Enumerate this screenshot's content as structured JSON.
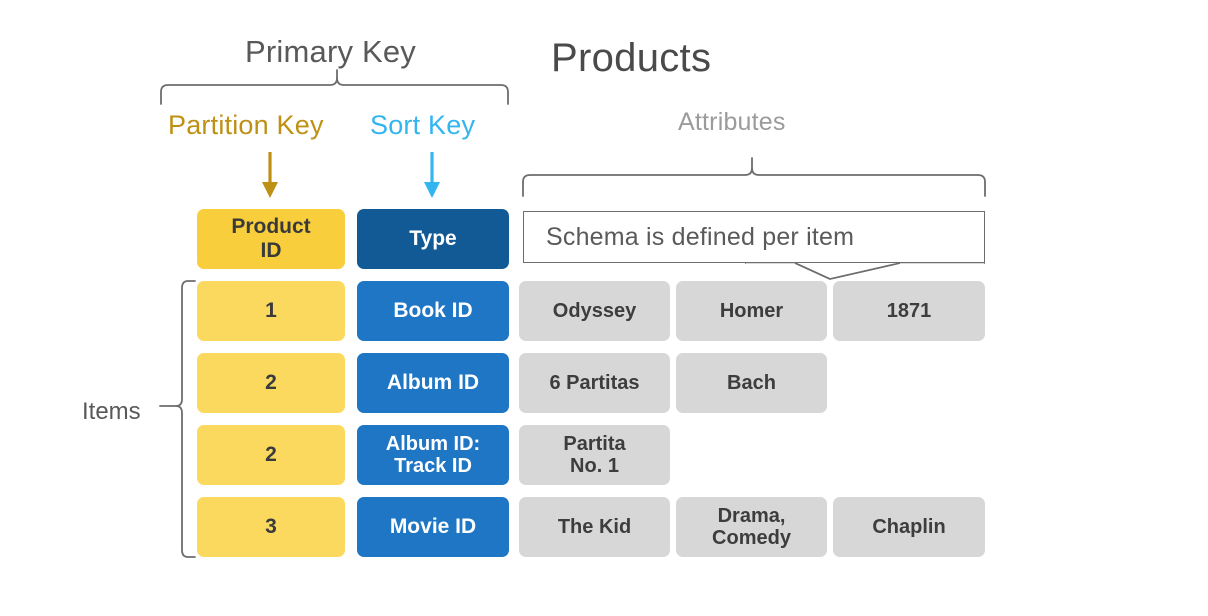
{
  "title": "Products",
  "labels": {
    "primary_key": "Primary Key",
    "partition_key": "Partition Key",
    "sort_key": "Sort Key",
    "attributes": "Attributes",
    "items": "Items"
  },
  "callout": {
    "text": "Schema is defined per item"
  },
  "colors": {
    "partition_key_text": "#BE9115",
    "sort_key_text": "#33B5F0",
    "primary_key_text": "#595959",
    "attributes_text": "#9B9B9B",
    "title_text": "#4A4A4A",
    "pk_header_fill": "#F9CE3C",
    "pk_cell_fill": "#FBD95F",
    "sk_header_fill": "#125A95",
    "sk_cell_fill": "#1E76C4",
    "attribute_fill": "#D7D7D7",
    "brace_stroke": "#6D6D6D"
  },
  "table": {
    "headers": {
      "partition_key": "Product\nID",
      "partition_key_line1": "Product",
      "partition_key_line2": "ID",
      "sort_key": "Type"
    },
    "rows": [
      {
        "product_id": "1",
        "type": "Book ID",
        "type_line1": "Book ID",
        "type_line2": "",
        "attributes": [
          "Odyssey",
          "Homer",
          "1871"
        ]
      },
      {
        "product_id": "2",
        "type": "Album ID",
        "type_line1": "Album  ID",
        "type_line2": "",
        "attributes": [
          "6 Partitas",
          "Bach"
        ]
      },
      {
        "product_id": "2",
        "type": "Album ID: Track ID",
        "type_line1": "Album  ID:",
        "type_line2": "Track ID",
        "attributes": [
          "Partita\nNo. 1"
        ]
      },
      {
        "product_id": "3",
        "type": "Movie ID",
        "type_line1": "Movie ID",
        "type_line2": "",
        "attributes": [
          "The Kid",
          "Drama,\nComedy",
          "Chaplin"
        ]
      }
    ]
  },
  "cells": {
    "r0c0_l1": "Odyssey",
    "r0c1_l1": "Homer",
    "r0c2_l1": "1871",
    "r1c0_l1": "6 Partitas",
    "r1c1_l1": "Bach",
    "r2c0_l1": "Partita",
    "r2c0_l2": "No. 1",
    "r3c0_l1": "The Kid",
    "r3c1_l1": "Drama,",
    "r3c1_l2": "Comedy",
    "r3c2_l1": "Chaplin"
  },
  "icons": {
    "partition_arrow": "down-arrow-icon",
    "sort_arrow": "down-arrow-icon",
    "primary_key_brace": "top-brace-icon",
    "attributes_brace": "top-brace-icon",
    "items_brace": "left-brace-icon"
  }
}
